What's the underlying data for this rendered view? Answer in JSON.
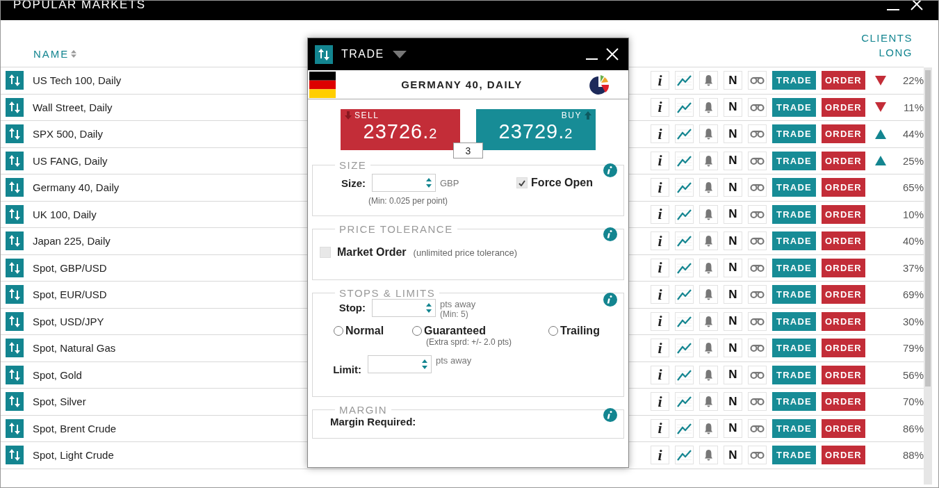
{
  "window": {
    "title": "POPULAR MARKETS"
  },
  "table": {
    "columns": {
      "name": "NAME",
      "clients_long": "CLIENTS LONG"
    },
    "rows": [
      {
        "name": "US Tech 100, Daily",
        "info": "i",
        "news": "N",
        "trade": "TRADE",
        "order": "ORDER",
        "kind": "falling",
        "clients_long": "22%"
      },
      {
        "name": "Wall Street, Daily",
        "info": "i",
        "news": "N",
        "trade": "TRADE",
        "order": "ORDER",
        "kind": "falling",
        "clients_long": "11%"
      },
      {
        "name": "SPX 500, Daily",
        "info": "i",
        "news": "N",
        "trade": "TRADE",
        "order": "ORDER",
        "kind": "rising",
        "clients_long": "44%"
      },
      {
        "name": "US FANG, Daily",
        "info": "i",
        "news": "N",
        "trade": "TRADE",
        "order": "ORDER",
        "kind": "rising",
        "clients_long": "25%"
      },
      {
        "name": "Germany 40, Daily",
        "info": "i",
        "news": "N",
        "trade": "TRADE",
        "order": "ORDER",
        "kind": "plain",
        "clients_long": "65%"
      },
      {
        "name": "UK 100, Daily",
        "info": "i",
        "news": "N",
        "trade": "TRADE",
        "order": "ORDER",
        "kind": "plain",
        "clients_long": "10%"
      },
      {
        "name": "Japan 225, Daily",
        "info": "i",
        "news": "N",
        "trade": "TRADE",
        "order": "ORDER",
        "kind": "plain",
        "clients_long": "40%"
      },
      {
        "name": "Spot, GBP/USD",
        "info": "i",
        "news": "N",
        "trade": "TRADE",
        "order": "ORDER",
        "kind": "plain",
        "clients_long": "37%"
      },
      {
        "name": "Spot, EUR/USD",
        "info": "i",
        "news": "N",
        "trade": "TRADE",
        "order": "ORDER",
        "kind": "plain",
        "clients_long": "69%"
      },
      {
        "name": "Spot, USD/JPY",
        "info": "i",
        "news": "N",
        "trade": "TRADE",
        "order": "ORDER",
        "kind": "plain",
        "clients_long": "30%"
      },
      {
        "name": "Spot, Natural Gas",
        "info": "i",
        "news": "N",
        "trade": "TRADE",
        "order": "ORDER",
        "kind": "plain",
        "clients_long": "79%"
      },
      {
        "name": "Spot, Gold",
        "info": "i",
        "news": "N",
        "trade": "TRADE",
        "order": "ORDER",
        "kind": "plain",
        "clients_long": "56%"
      },
      {
        "name": "Spot, Silver",
        "info": "i",
        "news": "N",
        "trade": "TRADE",
        "order": "ORDER",
        "kind": "plain",
        "clients_long": "70%"
      },
      {
        "name": "Spot, Brent Crude",
        "info": "i",
        "news": "N",
        "trade": "TRADE",
        "order": "ORDER",
        "kind": "plain",
        "clients_long": "86%"
      },
      {
        "name": "Spot, Light Crude",
        "info": "i",
        "news": "N",
        "trade": "TRADE",
        "order": "ORDER",
        "kind": "plain",
        "clients_long": "88%"
      }
    ]
  },
  "trade_ticket": {
    "title": "TRADE",
    "market": "GERMANY 40, DAILY",
    "sell": {
      "label": "SELL",
      "price_main": "23726.",
      "price_pip": "2"
    },
    "buy": {
      "label": "BUY",
      "price_main": "23729.",
      "price_pip": "2"
    },
    "spread": "3",
    "size": {
      "legend": "SIZE",
      "label": "Size:",
      "unit": "GBP",
      "note": "(Min: 0.025 per point)",
      "force_open": {
        "label": "Force Open",
        "checked": true
      }
    },
    "price_tolerance": {
      "legend": "PRICE TOLERANCE",
      "market_order": {
        "label": "Market Order",
        "checked": false
      },
      "note": "(unlimited price tolerance)"
    },
    "stops_limits": {
      "legend": "STOPS & LIMITS",
      "stop": {
        "label": "Stop:",
        "unit": "pts away",
        "note": "(Min: 5)"
      },
      "stop_types": [
        {
          "label": "Normal",
          "selected": false
        },
        {
          "label": "Guaranteed",
          "selected": false,
          "note": "(Extra sprd: +/- 2.0 pts)"
        },
        {
          "label": "Trailing",
          "selected": false
        }
      ],
      "limit": {
        "label": "Limit:",
        "unit": "pts away"
      }
    },
    "margin": {
      "legend": "MARGIN",
      "label": "Margin Required:"
    }
  }
}
